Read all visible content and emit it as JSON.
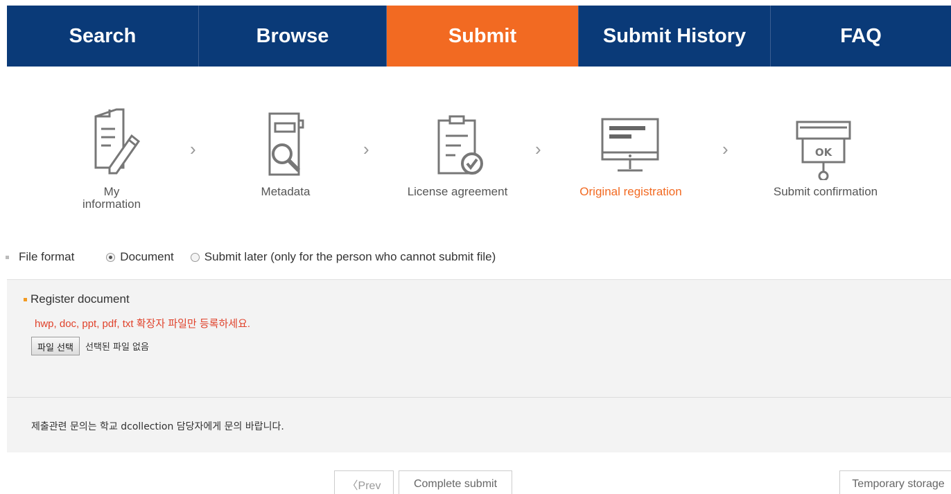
{
  "nav": {
    "items": [
      {
        "label": "Search"
      },
      {
        "label": "Browse"
      },
      {
        "label": "Submit"
      },
      {
        "label": "Submit History"
      },
      {
        "label": "FAQ"
      }
    ],
    "active_index": 2
  },
  "steps": [
    {
      "line1": "My",
      "line2": "information",
      "icon": "document-pen-icon"
    },
    {
      "line1": "Metadata",
      "line2": "",
      "icon": "magnifier-document-icon"
    },
    {
      "line1": "License agreement",
      "line2": "",
      "icon": "license-check-icon"
    },
    {
      "line1": "Original registration",
      "line2": "",
      "icon": "monitor-icon",
      "active": true
    },
    {
      "line1": "Submit confirmation",
      "line2": "",
      "icon": "ok-stamp-icon"
    }
  ],
  "step_separator": "›",
  "file_format": {
    "label": "File format",
    "options": [
      {
        "label": "Document",
        "checked": true
      },
      {
        "label": "Submit later (only for the person who cannot submit file)",
        "checked": false
      }
    ]
  },
  "register": {
    "title": "Register document",
    "hint": "hwp, doc, ppt, pdf, txt 확장자 파일만 등록하세요.",
    "file_button": "파일 선택",
    "file_status": "선택된 파일 없음"
  },
  "notice": {
    "text": "제출관련 문의는 학교 dcollection 담당자에게 문의 바랍니다."
  },
  "buttons": {
    "prev": "〈Prev",
    "complete": "Complete submit",
    "temporary": "Temporary storage"
  },
  "colors": {
    "nav_bg": "#0a3a78",
    "accent": "#f26a22",
    "hint_red": "#e0422b"
  }
}
